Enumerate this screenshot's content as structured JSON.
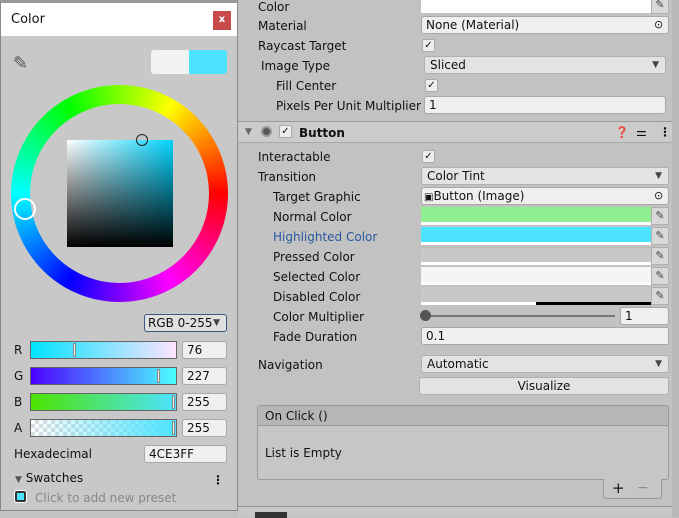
{
  "picker": {
    "title": "Color",
    "close": "x",
    "mode": "RGB 0-255",
    "channels": [
      {
        "label": "R",
        "value": "76",
        "frac": 0.298
      },
      {
        "label": "G",
        "value": "227",
        "frac": 0.89
      },
      {
        "label": "B",
        "value": "255",
        "frac": 1
      },
      {
        "label": "A",
        "value": "255",
        "frac": 1
      }
    ],
    "hex_label": "Hexadecimal",
    "hex": "4CE3FF",
    "swatches": "Swatches",
    "add_preset": "Click to add new preset",
    "current_color": "#4CE3FF"
  },
  "image": {
    "color": "Color",
    "material": "Material",
    "material_value": "None (Material)",
    "raycast": "Raycast Target",
    "image_type": "Image Type",
    "image_type_value": "Sliced",
    "fill_center": "Fill Center",
    "ppu": "Pixels Per Unit Multiplier",
    "ppu_value": "1"
  },
  "button": {
    "title": "Button",
    "interactable": "Interactable",
    "transition": "Transition",
    "transition_value": "Color Tint",
    "target_graphic": "Target Graphic",
    "target_graphic_value": "Button (Image)",
    "colors": [
      {
        "label": "Normal Color",
        "color": "#90EE90"
      },
      {
        "label": "Highlighted Color",
        "color": "#4CE3FF"
      },
      {
        "label": "Pressed Color",
        "color": "#C8C8C8"
      },
      {
        "label": "Selected Color",
        "color": "#F5F5F5"
      },
      {
        "label": "Disabled Color",
        "color": "#C8C8C8"
      }
    ],
    "multiplier": "Color Multiplier",
    "multiplier_value": "1",
    "fade": "Fade Duration",
    "fade_value": "0.1",
    "navigation": "Navigation",
    "navigation_value": "Automatic",
    "visualize": "Visualize",
    "onclick": "On Click ()",
    "empty": "List is Empty",
    "plus": "+",
    "minus": "−"
  }
}
